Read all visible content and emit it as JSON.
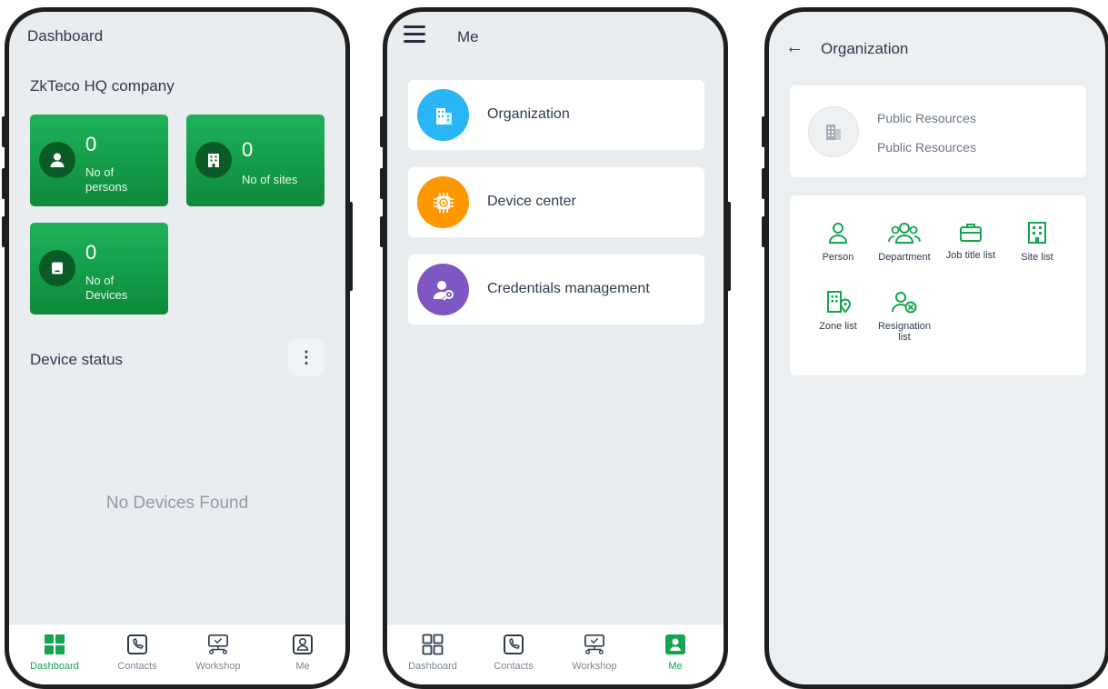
{
  "colors": {
    "accent": "#13a54f",
    "tile_green": "#16a34a",
    "text": "#2d3b4e"
  },
  "phone1": {
    "title": "Dashboard",
    "company": "ZkTeco HQ company",
    "tiles": [
      {
        "icon": "person-icon",
        "value": "0",
        "label_line1": "No of",
        "label_line2": "persons"
      },
      {
        "icon": "building-icon",
        "value": "0",
        "label_line1": "No of sites",
        "label_line2": ""
      },
      {
        "icon": "device-icon",
        "value": "0",
        "label_line1": "No of",
        "label_line2": "Devices"
      }
    ],
    "device_status": "Device status",
    "empty_message": "No Devices Found"
  },
  "phone2": {
    "title": "Me",
    "menu": [
      {
        "label": "Organization",
        "icon": "building-icon",
        "color": "#29b6f6"
      },
      {
        "label": "Device center",
        "icon": "chip-icon",
        "color": "#ff9800"
      },
      {
        "label": "Credentials management",
        "icon": "user-key-icon",
        "color": "#7e57c2"
      }
    ]
  },
  "phone3": {
    "title": "Organization",
    "resource_line1": "Public Resources",
    "resource_line2": "Public Resources",
    "items": [
      {
        "label": "Person",
        "icon": "person-outline-icon"
      },
      {
        "label": "Department",
        "icon": "group-icon"
      },
      {
        "label": "Job title list",
        "icon": "briefcase-icon"
      },
      {
        "label": "Site list",
        "icon": "building-outline-icon"
      },
      {
        "label": "Zone list",
        "icon": "building-pin-icon"
      },
      {
        "label_line1": "Resignation",
        "label_line2": "list",
        "icon": "person-remove-icon"
      }
    ]
  },
  "tabs": [
    {
      "label": "Dashboard",
      "icon": "grid-icon"
    },
    {
      "label": "Contacts",
      "icon": "phone-icon"
    },
    {
      "label": "Workshop",
      "icon": "monitor-icon"
    },
    {
      "label": "Me",
      "icon": "user-icon"
    }
  ]
}
